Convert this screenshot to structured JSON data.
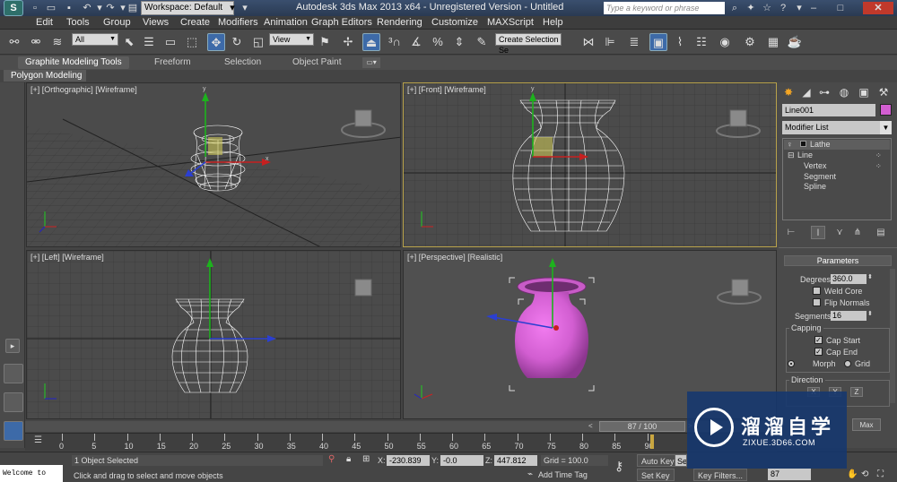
{
  "titlebar": {
    "logo": "S",
    "workspace": "Workspace: Default",
    "title": "Autodesk 3ds Max  2013 x64   - Unregistered Version  - Untitled",
    "search_placeholder": "Type a keyword or phrase"
  },
  "menu": [
    "Edit",
    "Tools",
    "Group",
    "Views",
    "Create",
    "Modifiers",
    "Animation",
    "Graph Editors",
    "Rendering",
    "Customize",
    "MAXScript",
    "Help"
  ],
  "toolbar": {
    "filter": "All",
    "coord_system": "View",
    "selection_set": "Create Selection Se"
  },
  "ribbon": {
    "tabs": [
      "Graphite Modeling Tools",
      "Freeform",
      "Selection",
      "Object Paint"
    ],
    "panel_label": "Polygon Modeling"
  },
  "viewports": [
    {
      "label": "[+] [Orthographic] [Wireframe]"
    },
    {
      "label": "[+] [Front] [Wireframe]"
    },
    {
      "label": "[+] [Left] [Wireframe]"
    },
    {
      "label": "[+] [Perspective] [Realistic]"
    }
  ],
  "command_panel": {
    "object_name": "Line001",
    "object_color": "#d25ed1",
    "modifier_list": "Modifier List",
    "stack": [
      "Lathe",
      "Line",
      "Vertex",
      "Segment",
      "Spline"
    ],
    "parameters_title": "Parameters",
    "degrees_label": "Degrees:",
    "degrees": "360.0",
    "weld_core": "Weld Core",
    "flip_normals": "Flip Normals",
    "segments_label": "Segments:",
    "segments": "16",
    "capping_label": "Capping",
    "cap_start": "Cap Start",
    "cap_end": "Cap End",
    "morph": "Morph",
    "grid": "Grid",
    "direction_label": "Direction",
    "x": "X",
    "y": "Y",
    "z": "Z",
    "max": "Max"
  },
  "timeline": {
    "frame_display": "87 / 100",
    "ticks": [
      "0",
      "5",
      "10",
      "15",
      "20",
      "25",
      "30",
      "35",
      "40",
      "45",
      "50",
      "55",
      "60",
      "65",
      "70",
      "75",
      "80",
      "85",
      "90"
    ]
  },
  "status": {
    "maxscript": "Welcome to MAX!",
    "selection": "1 Object Selected",
    "prompt": "Click and drag to select and move objects",
    "x_label": "X:",
    "x": "-230.839",
    "y_label": "Y:",
    "y": "-0.0",
    "z_label": "Z:",
    "z": "447.812",
    "grid": "Grid = 100.0",
    "add_time_tag": "Add Time Tag",
    "auto_key": "Auto Key",
    "selected": "Selected",
    "set_key": "Set Key",
    "key_filters": "Key Filters...",
    "frame": "87"
  },
  "watermark": {
    "brand": "溜溜自学",
    "url": "ZIXUE.3D66.COM"
  }
}
